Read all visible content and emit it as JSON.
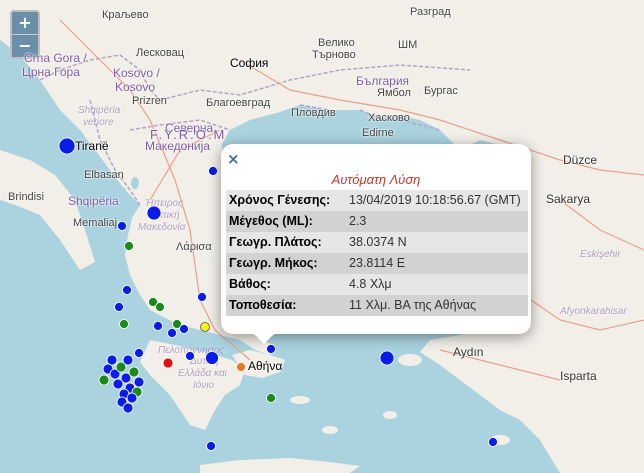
{
  "zoom": {
    "in_label": "+",
    "out_label": "−"
  },
  "labels": {
    "kraljevo": "Краљево",
    "razgrad": "Разград",
    "montenegro1": "Crna Gora /",
    "montenegro2": "Црна Гора",
    "leskovac": "Лесковац",
    "veliko": "Велико",
    "tarnovo": "Търново",
    "shumen": "ШМ",
    "kosovo1": "Kosovo /",
    "kosovo2": "Kosovo",
    "sofia": "София",
    "bulgaria": "България",
    "prizren": "Prizren",
    "blagoevgrad": "Благоевград",
    "yambol": "Ямбол",
    "burgas": "Бургас",
    "shqiperia_v": "Shqipëria",
    "veriore": "veriore",
    "severna": "Северна",
    "fyrom": "F.Y.R.O.M",
    "makedonija": "Македонија",
    "plovdiv": "Пловдив",
    "haskovo": "Хасково",
    "edirne": "Edirne",
    "tirane": "Tiranë",
    "elbasan": "Elbasan",
    "shqiperia": "Shqipëria",
    "brindisi": "Brindisi",
    "memaliaj": "Memaliaj",
    "hpeiros": "Ήπειρος",
    "makedonia_gr": "κτική",
    "makedonia_gr2": "Μακεδονία",
    "larisa": "Λάρισα",
    "duzce": "Düzce",
    "sakarya": "Sakarya",
    "eskisehir": "Eskişehir",
    "afyon": "Afyonkarahisar",
    "aydin": "Aydın",
    "isparta": "Isparta",
    "peloponnisos": "Πελοπόννησος",
    "dytiki1": "Δυτική",
    "dytiki2": "Ελλάδα και",
    "dytiki3": "Ιόνιο",
    "athina": "Αθήνα"
  },
  "popup": {
    "close_label": "×",
    "title": "Αυτόματη Λύση",
    "rows": [
      {
        "key": "Χρόνος Γένεσης:",
        "value": "13/04/2019 10:18:56.67 (GMT)"
      },
      {
        "key": "Μέγεθος (ML):",
        "value": "2.3"
      },
      {
        "key": "Γεωγρ. Πλάτος:",
        "value": "38.0374 N"
      },
      {
        "key": "Γεωγρ. Μήκος:",
        "value": "23.8114 E"
      },
      {
        "key": "Βάθος:",
        "value": "4.8 Χλμ"
      },
      {
        "key": "Τοποθεσία:",
        "value": "11 Χλμ. ΒΑ της Αθήνας"
      }
    ]
  },
  "markers": {
    "colors": {
      "blue": "#0a1ce8",
      "green": "#1a8a1a",
      "red": "#e01010",
      "orange": "#e87a1e",
      "yellow": "#f2f21a"
    }
  }
}
